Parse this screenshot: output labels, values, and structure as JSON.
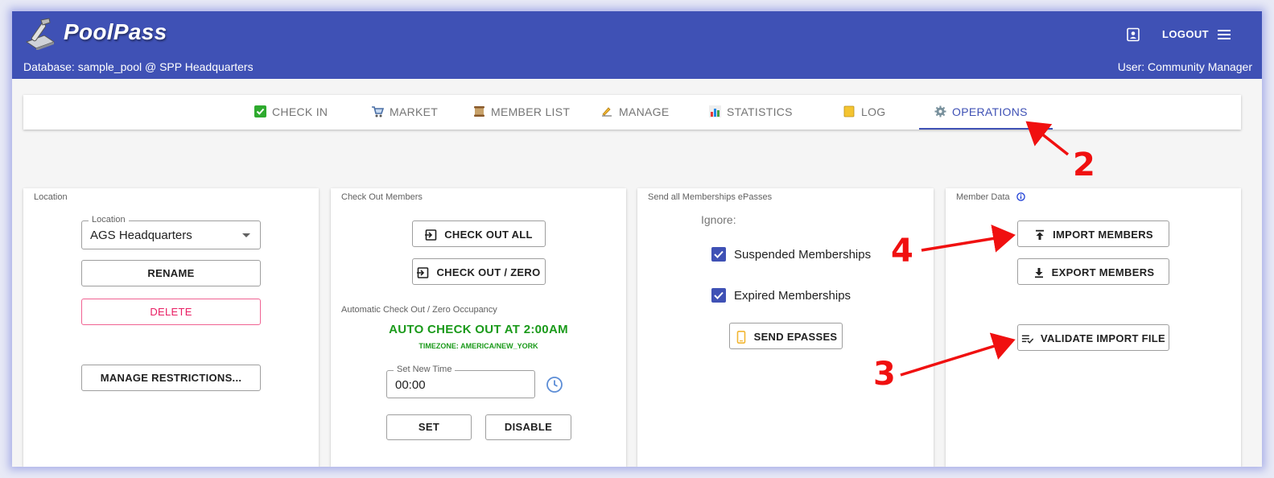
{
  "header": {
    "brand": "PoolPass",
    "database_line": "Database: sample_pool @ SPP Headquarters",
    "user_line": "User: Community Manager",
    "logout_label": "LOGOUT",
    "icons": [
      "poolpass-logo-icon",
      "contact-card-icon",
      "hamburger-menu-icon"
    ],
    "brand_color": "#3f51b5"
  },
  "tabs": [
    {
      "label": "CHECK IN",
      "icon": "check-mark-icon"
    },
    {
      "label": "MARKET",
      "icon": "shopping-cart-icon"
    },
    {
      "label": "MEMBER LIST",
      "icon": "scroll-icon"
    },
    {
      "label": "MANAGE",
      "icon": "writing-hand-icon"
    },
    {
      "label": "STATISTICS",
      "icon": "bar-chart-icon"
    },
    {
      "label": "LOG",
      "icon": "notebook-icon"
    },
    {
      "label": "OPERATIONS",
      "icon": "gear-icon",
      "active": true
    }
  ],
  "location_card": {
    "title": "Location",
    "field_label": "Location",
    "field_value": "AGS Headquarters",
    "rename_label": "RENAME",
    "delete_label": "DELETE",
    "restrictions_label": "MANAGE RESTRICTIONS..."
  },
  "checkout_card": {
    "title": "Check Out Members",
    "check_out_all_label": "CHECK OUT ALL",
    "check_out_zero_label": "CHECK OUT / ZERO",
    "auto_section_title": "Automatic Check Out / Zero Occupancy",
    "auto_status": "AUTO CHECK OUT AT 2:00AM",
    "timezone": "TIMEZONE: AMERICA/NEW_YORK",
    "time_field_label": "Set New Time",
    "time_field_value": "00:00",
    "set_label": "SET",
    "disable_label": "DISABLE",
    "status_color": "#1a9a1a"
  },
  "epass_card": {
    "title": "Send all Memberships ePasses",
    "ignore_label": "Ignore:",
    "suspended_label": "Suspended Memberships",
    "suspended_checked": true,
    "expired_label": "Expired Memberships",
    "expired_checked": true,
    "send_label": "SEND EPASSES"
  },
  "member_data_card": {
    "title": "Member Data",
    "import_label": "IMPORT MEMBERS",
    "export_label": "EXPORT MEMBERS",
    "validate_label": "VALIDATE IMPORT FILE"
  },
  "annotations": {
    "tab_marker": "2",
    "validate_marker": "3",
    "import_marker": "4",
    "color": "#f01010"
  }
}
